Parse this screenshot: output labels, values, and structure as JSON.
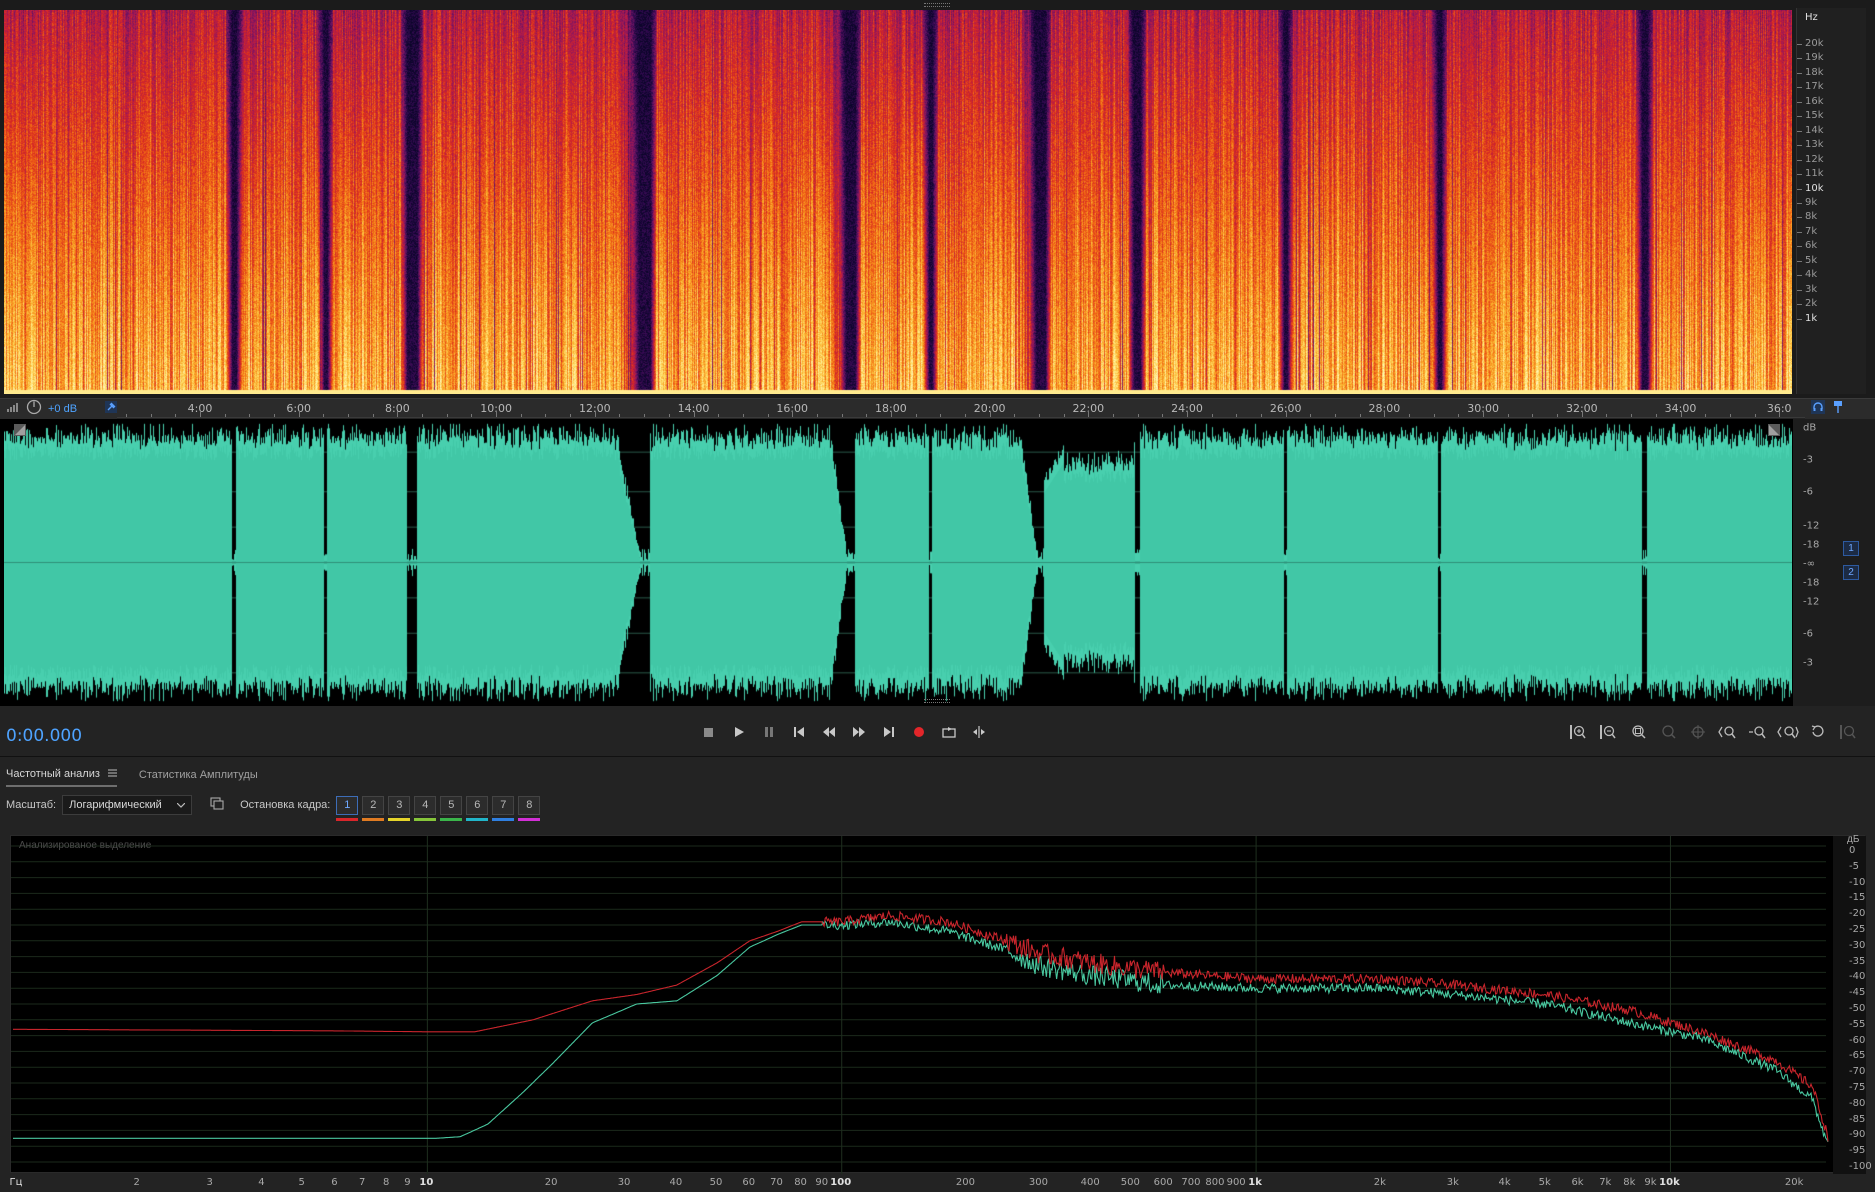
{
  "spectral": {
    "unit_label": "Hz",
    "freq_labels": [
      "20k",
      "19k",
      "18k",
      "17k",
      "16k",
      "15k",
      "14k",
      "13k",
      "12k",
      "11k",
      "10k",
      "9k",
      "8k",
      "7k",
      "6k",
      "5k",
      "4k",
      "3k",
      "2k",
      "1k"
    ]
  },
  "ruler": {
    "gain": "+0 dB",
    "time_labels": [
      "4:00",
      "6:00",
      "8:00",
      "10:00",
      "12:00",
      "14:00",
      "16:00",
      "18:00",
      "20:00",
      "22:00",
      "24:00",
      "26:00",
      "28:00",
      "30:00",
      "32:00",
      "34:00",
      "36:0"
    ]
  },
  "waveform": {
    "unit_label": "dB",
    "db_labels": [
      "-3",
      "-6",
      "-12",
      "-18",
      "-∞",
      "-18",
      "-12",
      "-6",
      "-3"
    ],
    "channels": [
      "1",
      "2"
    ]
  },
  "transport": {
    "time": "0:00.000"
  },
  "panel": {
    "tabs": [
      "Частотный анализ",
      "Статистика Амплитуды"
    ],
    "scale_label": "Масштаб:",
    "scale_value": "Логарифмический",
    "frame_hold_label": "Остановка кадра:",
    "frames": [
      {
        "label": "1",
        "color": "#d9262b"
      },
      {
        "label": "2",
        "color": "#e07b22"
      },
      {
        "label": "3",
        "color": "#e5d42a"
      },
      {
        "label": "4",
        "color": "#86c63a"
      },
      {
        "label": "5",
        "color": "#3ab54a"
      },
      {
        "label": "6",
        "color": "#21b5c9"
      },
      {
        "label": "7",
        "color": "#2f7fe0"
      },
      {
        "label": "8",
        "color": "#d22fd6"
      }
    ]
  },
  "graph": {
    "caption": "Анализированое выделение",
    "db_unit": "дБ",
    "db_labels": [
      "0",
      "-5",
      "-10",
      "-15",
      "-20",
      "-25",
      "-30",
      "-35",
      "-40",
      "-45",
      "-50",
      "-55",
      "-60",
      "-65",
      "-70",
      "-75",
      "-80",
      "-85",
      "-90",
      "-95",
      "-100"
    ],
    "freq_unit": "Гц",
    "freq_labels": [
      "2",
      "3",
      "4",
      "5",
      "6",
      "7",
      "8",
      "9",
      "10",
      "20",
      "30",
      "40",
      "50",
      "60",
      "70",
      "80",
      "90",
      "100",
      "200",
      "300",
      "400",
      "500",
      "600",
      "700",
      "800",
      "900",
      "1k",
      "2k",
      "3k",
      "4k",
      "5k",
      "6k",
      "7k",
      "8k",
      "9k",
      "10k",
      "20k"
    ],
    "series_colors": [
      "#c8252c",
      "#49c79f"
    ]
  }
}
